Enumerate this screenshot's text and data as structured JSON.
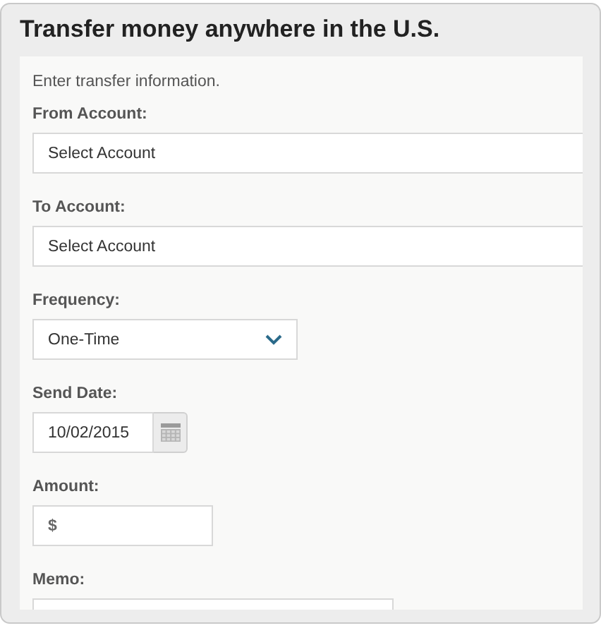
{
  "title": "Transfer money anywhere in the U.S.",
  "intro": "Enter transfer information.",
  "fields": [
    {
      "kind": "account",
      "label": "From Account:",
      "value": "Select Account"
    },
    {
      "kind": "account",
      "label": "To Account:",
      "value": "Select Account"
    },
    {
      "kind": "dropdown",
      "label": "Frequency:",
      "value": "One-Time"
    },
    {
      "kind": "date",
      "label": "Send Date:",
      "value": "10/02/2015"
    },
    {
      "kind": "currency",
      "label": "Amount:",
      "prefix": "$"
    },
    {
      "kind": "text",
      "label": "Memo:"
    }
  ]
}
